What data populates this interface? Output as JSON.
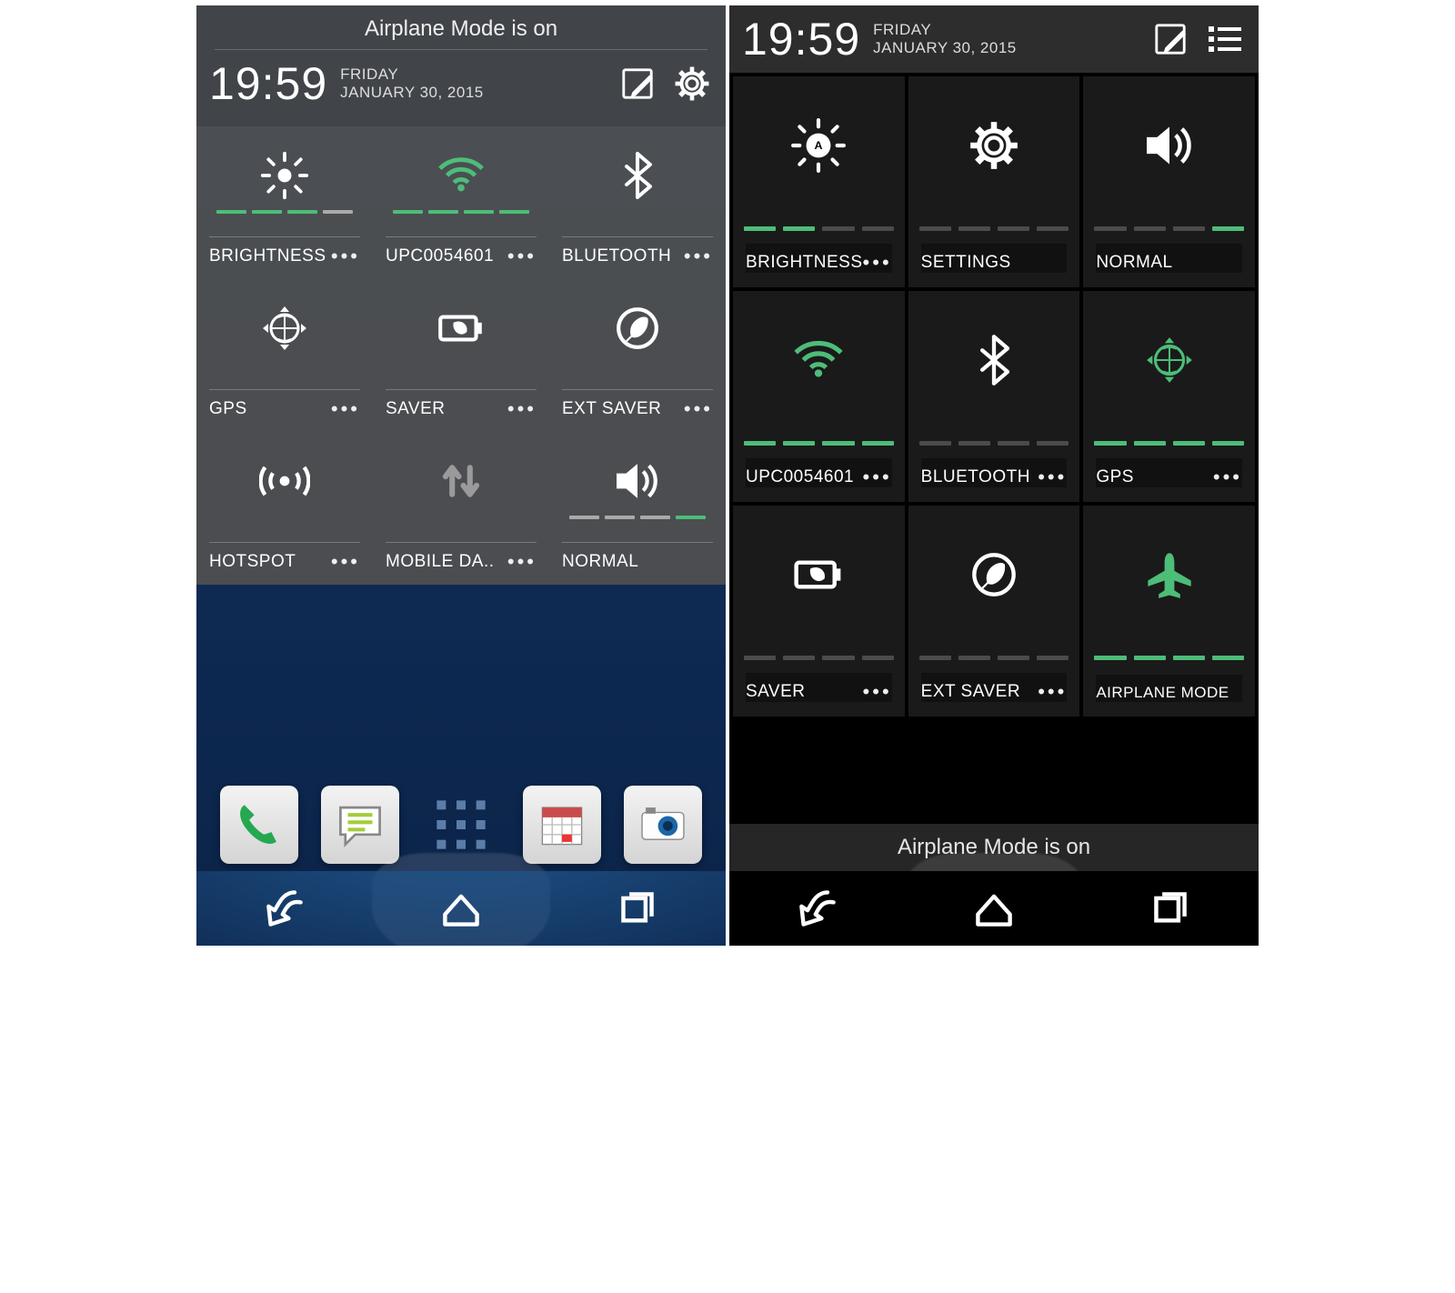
{
  "colors": {
    "accent": "#4dbd78"
  },
  "left": {
    "banner": "Airplane Mode is on",
    "time": "19:59",
    "day": "FRIDAY",
    "date": "JANUARY 30, 2015",
    "tiles": [
      {
        "id": "brightness",
        "label": "BRIGHTNESS",
        "icon": "brightness-icon",
        "has_dots": true,
        "slider": [
          true,
          true,
          true,
          false
        ]
      },
      {
        "id": "wifi",
        "label": "UPC0054601",
        "icon": "wifi-icon",
        "has_dots": true,
        "active": true,
        "slider": [
          true,
          true,
          true,
          true
        ]
      },
      {
        "id": "bluetooth",
        "label": "BLUETOOTH",
        "icon": "bluetooth-icon",
        "has_dots": true
      },
      {
        "id": "gps",
        "label": "GPS",
        "icon": "gps-icon",
        "has_dots": true
      },
      {
        "id": "saver",
        "label": "SAVER",
        "icon": "battery-saver-icon",
        "has_dots": true
      },
      {
        "id": "ext-saver",
        "label": "EXT SAVER",
        "icon": "leaf-circle-icon",
        "has_dots": true
      },
      {
        "id": "hotspot",
        "label": "HOTSPOT",
        "icon": "hotspot-icon",
        "has_dots": true
      },
      {
        "id": "mobile-data",
        "label": "MOBILE DA..",
        "icon": "mobile-data-icon",
        "has_dots": true,
        "dim": true
      },
      {
        "id": "normal",
        "label": "NORMAL",
        "icon": "volume-icon",
        "has_dots": false,
        "slider": [
          false,
          false,
          false,
          true
        ]
      }
    ],
    "dock": [
      "phone",
      "messages",
      "apps",
      "calendar",
      "camera"
    ]
  },
  "right": {
    "time": "19:59",
    "day": "FRIDAY",
    "date": "JANUARY 30, 2015",
    "tiles": [
      {
        "id": "brightness",
        "label": "BRIGHTNESS",
        "icon": "brightness-auto-icon",
        "has_dots": true,
        "slider": [
          true,
          true,
          false,
          false
        ]
      },
      {
        "id": "settings",
        "label": "SETTINGS",
        "icon": "gear-icon",
        "has_dots": false
      },
      {
        "id": "normal",
        "label": "NORMAL",
        "icon": "volume-icon",
        "has_dots": false,
        "slider": [
          false,
          false,
          false,
          true
        ]
      },
      {
        "id": "wifi",
        "label": "UPC0054601",
        "icon": "wifi-icon",
        "has_dots": true,
        "active": true,
        "slider": [
          true,
          true,
          true,
          true
        ]
      },
      {
        "id": "bluetooth",
        "label": "BLUETOOTH",
        "icon": "bluetooth-icon",
        "has_dots": true
      },
      {
        "id": "gps",
        "label": "GPS",
        "icon": "gps-icon",
        "has_dots": true,
        "active": true,
        "slider": [
          true,
          true,
          true,
          true
        ]
      },
      {
        "id": "saver",
        "label": "SAVER",
        "icon": "battery-saver-icon",
        "has_dots": true
      },
      {
        "id": "ext-saver",
        "label": "EXT SAVER",
        "icon": "leaf-circle-icon",
        "has_dots": true
      },
      {
        "id": "airplane",
        "label": "AIRPLANE MODE",
        "icon": "airplane-icon",
        "has_dots": false,
        "active": true,
        "slider": [
          true,
          true,
          true,
          true
        ]
      }
    ],
    "banner": "Airplane Mode is on"
  }
}
